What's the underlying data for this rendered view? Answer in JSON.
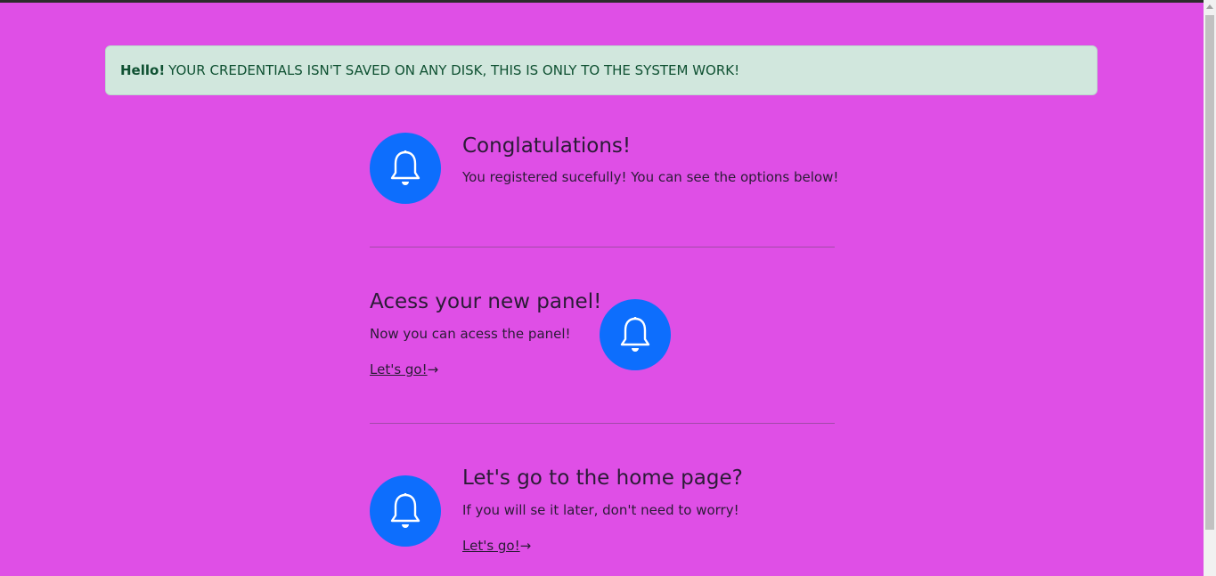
{
  "alert": {
    "strong": "Hello!",
    "message": "YOUR CREDENTIALS ISN'T SAVED ON ANY DISK, THIS IS ONLY TO THE SYSTEM WORK!"
  },
  "features": [
    {
      "title": "Conglatulations!",
      "text": "You registered sucefully! You can see the options below!",
      "icon": "bell-icon"
    },
    {
      "title": "Acess your new panel!",
      "text": "Now you can acess the panel!",
      "link": "Let's go!",
      "link_arrow": "→",
      "icon": "bell-icon"
    },
    {
      "title": "Let's go to the home page?",
      "text": "If you will se it later, don't need to worry!",
      "link": "Let's go!",
      "link_arrow": "→",
      "icon": "bell-icon"
    }
  ],
  "colors": {
    "background": "#df4fe6",
    "icon_circle": "#0d6efd",
    "alert_bg": "#d1e7dd",
    "alert_text": "#0f5132"
  }
}
